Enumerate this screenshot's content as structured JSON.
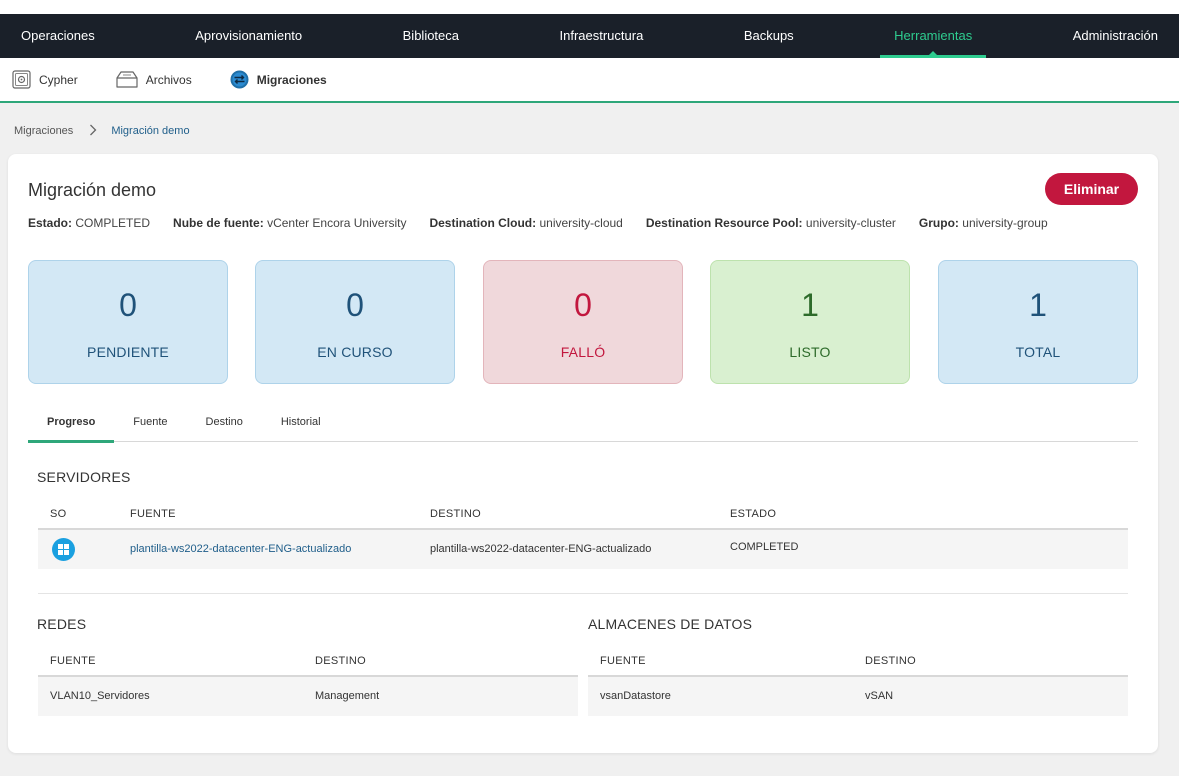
{
  "nav": {
    "items": [
      "Operaciones",
      "Aprovisionamiento",
      "Biblioteca",
      "Infraestructura",
      "Backups",
      "Herramientas",
      "Administración"
    ],
    "active_index": 5,
    "active_color": "#2ecc8f"
  },
  "subnav": {
    "items": [
      {
        "label": "Cypher",
        "icon": "safe-icon"
      },
      {
        "label": "Archivos",
        "icon": "folder-icon"
      },
      {
        "label": "Migraciones",
        "icon": "migration-icon"
      }
    ],
    "active_index": 2
  },
  "breadcrumb": {
    "parent": "Migraciones",
    "separator": ">",
    "current": "Migración demo"
  },
  "migration": {
    "title": "Migración demo",
    "delete_label": "Eliminar",
    "meta": [
      {
        "key": "Estado:",
        "value": "COMPLETED"
      },
      {
        "key": "Nube de fuente:",
        "value": "vCenter Encora University"
      },
      {
        "key": "Destination Cloud:",
        "value": "university-cloud"
      },
      {
        "key": "Destination Resource Pool:",
        "value": "university-cluster"
      },
      {
        "key": "Grupo:",
        "value": "university-group"
      }
    ]
  },
  "stats": [
    {
      "value": "0",
      "label": "PENDIENTE",
      "color": "#1f5279"
    },
    {
      "value": "0",
      "label": "EN CURSO",
      "color": "#1f5279"
    },
    {
      "value": "0",
      "label": "FALLÓ",
      "color": "#c2173e"
    },
    {
      "value": "1",
      "label": "LISTO",
      "color": "#2d6b2a"
    },
    {
      "value": "1",
      "label": "TOTAL",
      "color": "#1f5279"
    }
  ],
  "tabs": {
    "items": [
      "Progreso",
      "Fuente",
      "Destino",
      "Historial"
    ],
    "active_index": 0
  },
  "servers": {
    "title": "SERVIDORES",
    "headers": [
      "SO",
      "FUENTE",
      "DESTINO",
      "ESTADO"
    ],
    "rows": [
      {
        "os_icon": "windows-icon",
        "source": "plantilla-ws2022-datacenter-ENG-actualizado",
        "destination": "plantilla-ws2022-datacenter-ENG-actualizado",
        "status": "COMPLETED"
      }
    ]
  },
  "networks": {
    "title": "REDES",
    "headers": [
      "FUENTE",
      "DESTINO"
    ],
    "rows": [
      {
        "source": "VLAN10_Servidores",
        "destination": "Management"
      }
    ]
  },
  "datastores": {
    "title": "ALMACENES DE DATOS",
    "headers": [
      "FUENTE",
      "DESTINO"
    ],
    "rows": [
      {
        "source": "vsanDatastore",
        "destination": "vSAN"
      }
    ]
  }
}
